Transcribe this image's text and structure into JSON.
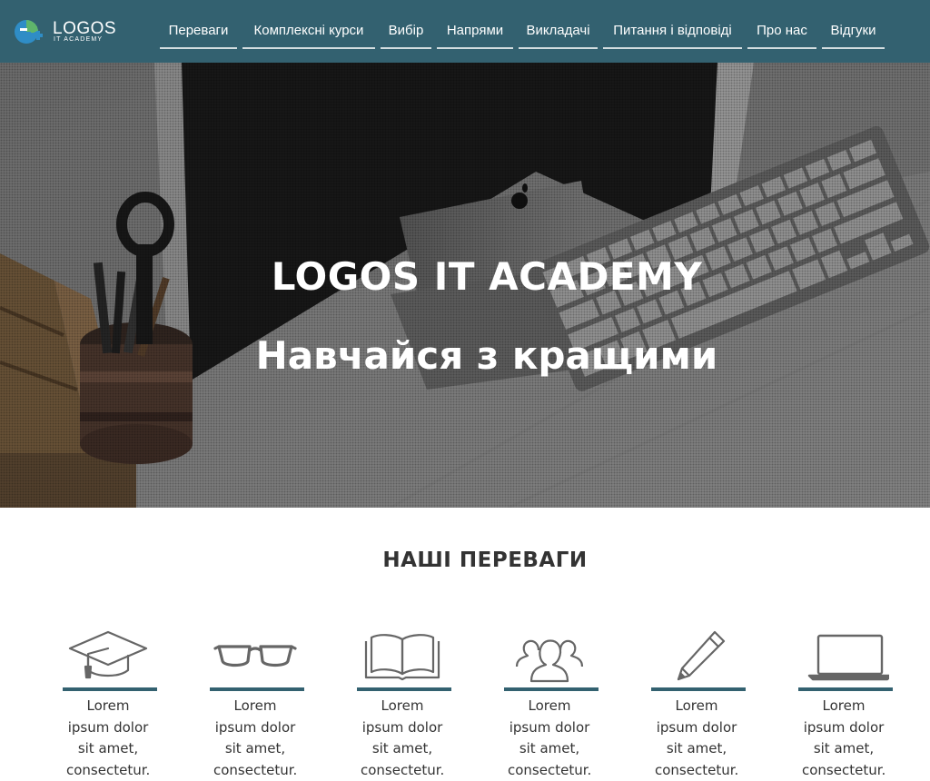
{
  "brand": {
    "name": "LOGOS",
    "tagline": "IT ACADEMY",
    "colors": {
      "nav_bg": "#336170",
      "accent": "#336170",
      "logo_green": "#5fb56b",
      "logo_blue": "#2f8dc6"
    }
  },
  "nav": {
    "items": [
      {
        "label": "Переваги"
      },
      {
        "label": "Комплексні курси"
      },
      {
        "label": "Вибір"
      },
      {
        "label": "Напрями"
      },
      {
        "label": "Викладачі"
      },
      {
        "label": "Питання і відповіді"
      },
      {
        "label": "Про нас"
      },
      {
        "label": "Відгуки"
      }
    ]
  },
  "hero": {
    "title": "LOGOS IT ACADEMY",
    "subtitle": "Навчайся з кращими"
  },
  "advantages": {
    "heading": "НАШІ ПЕРЕВАГИ",
    "items": [
      {
        "icon": "graduation-cap-icon",
        "text": "Lorem ipsum dolor sit amet, consectetur."
      },
      {
        "icon": "glasses-icon",
        "text": "Lorem ipsum dolor sit amet, consectetur."
      },
      {
        "icon": "open-book-icon",
        "text": "Lorem ipsum dolor sit amet, consectetur."
      },
      {
        "icon": "users-icon",
        "text": "Lorem ipsum dolor sit amet, consectetur."
      },
      {
        "icon": "pencil-icon",
        "text": "Lorem ipsum dolor sit amet, consectetur."
      },
      {
        "icon": "laptop-icon",
        "text": "Lorem ipsum dolor sit amet, consectetur."
      }
    ]
  }
}
